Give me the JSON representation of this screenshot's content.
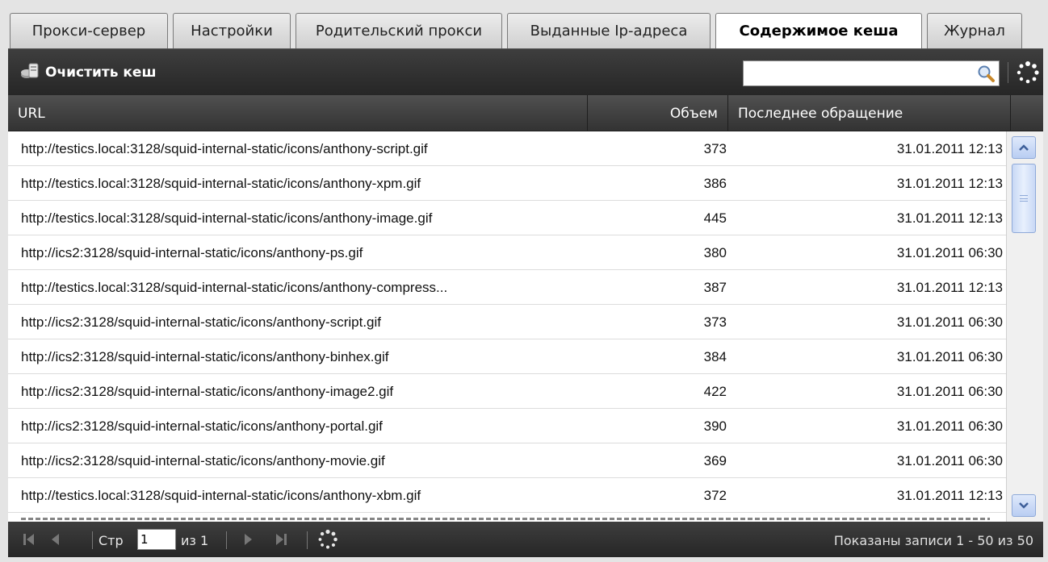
{
  "tabs": [
    {
      "label": "Прокси-сервер",
      "active": false
    },
    {
      "label": "Настройки",
      "active": false
    },
    {
      "label": "Родительский прокси",
      "active": false
    },
    {
      "label": "Выданные Ip-адреса",
      "active": false
    },
    {
      "label": "Содержимое кеша",
      "active": true
    },
    {
      "label": "Журнал",
      "active": false
    }
  ],
  "toolbar": {
    "clear_cache_label": "Очистить кеш",
    "clear_cache_icon": "clear-cache-icon",
    "search_value": "",
    "search_icon": "search-icon",
    "refresh_icon": "refresh-icon"
  },
  "grid": {
    "columns": [
      "URL",
      "Объем",
      "Последнее обращение"
    ],
    "rows": [
      {
        "url": "http://testics.local:3128/squid-internal-static/icons/anthony-script.gif",
        "size": "373",
        "date": "31.01.2011 12:13"
      },
      {
        "url": "http://testics.local:3128/squid-internal-static/icons/anthony-xpm.gif",
        "size": "386",
        "date": "31.01.2011 12:13"
      },
      {
        "url": "http://testics.local:3128/squid-internal-static/icons/anthony-image.gif",
        "size": "445",
        "date": "31.01.2011 12:13"
      },
      {
        "url": "http://ics2:3128/squid-internal-static/icons/anthony-ps.gif",
        "size": "380",
        "date": "31.01.2011 06:30"
      },
      {
        "url": "http://testics.local:3128/squid-internal-static/icons/anthony-compress...",
        "size": "387",
        "date": "31.01.2011 12:13"
      },
      {
        "url": "http://ics2:3128/squid-internal-static/icons/anthony-script.gif",
        "size": "373",
        "date": "31.01.2011 06:30"
      },
      {
        "url": "http://ics2:3128/squid-internal-static/icons/anthony-binhex.gif",
        "size": "384",
        "date": "31.01.2011 06:30"
      },
      {
        "url": "http://ics2:3128/squid-internal-static/icons/anthony-image2.gif",
        "size": "422",
        "date": "31.01.2011 06:30"
      },
      {
        "url": "http://ics2:3128/squid-internal-static/icons/anthony-portal.gif",
        "size": "390",
        "date": "31.01.2011 06:30"
      },
      {
        "url": "http://ics2:3128/squid-internal-static/icons/anthony-movie.gif",
        "size": "369",
        "date": "31.01.2011 06:30"
      },
      {
        "url": "http://testics.local:3128/squid-internal-static/icons/anthony-xbm.gif",
        "size": "372",
        "date": "31.01.2011 12:13"
      }
    ]
  },
  "pager": {
    "page_label": "Стр",
    "page_value": "1",
    "of_label": "из 1",
    "status": "Показаны записи 1 - 50 из 50",
    "icons": [
      "first-page-icon",
      "prev-page-icon",
      "next-page-icon",
      "last-page-icon",
      "refresh-icon"
    ]
  },
  "colors": {
    "toolbar_bg": "#2e2e2e",
    "header_bg": "#3a3a3a",
    "tabbar_bg": "#e4e4e4",
    "scroll_accent": "#b9cdf2"
  }
}
